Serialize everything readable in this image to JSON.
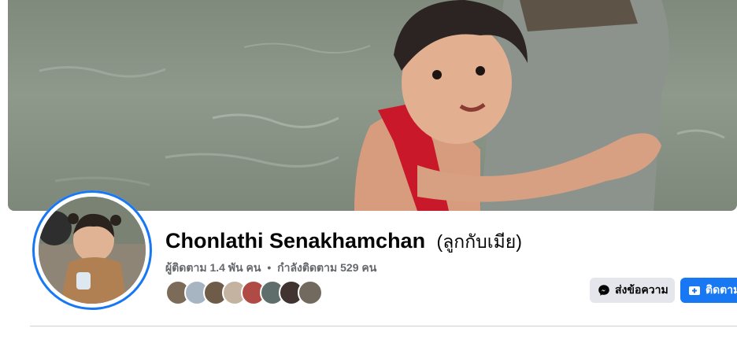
{
  "profile": {
    "name": "Chonlathi Senakhamchan",
    "alternate_name": "(ลูกกับเมีย)",
    "followers": "ผู้ติดตาม 1.4 พัน คน",
    "separator": "•",
    "following": "กำลังติดตาม 529 คน"
  },
  "actions": {
    "message_label": "ส่งข้อความ",
    "follow_label": "ติดตาม"
  },
  "icons": {
    "message": "messenger-icon",
    "follow": "follow-plus-icon"
  },
  "colors": {
    "accent": "#1877f2",
    "secondary_button": "#e4e6eb",
    "muted_text": "#65676b"
  },
  "friends_preview_count": 8
}
